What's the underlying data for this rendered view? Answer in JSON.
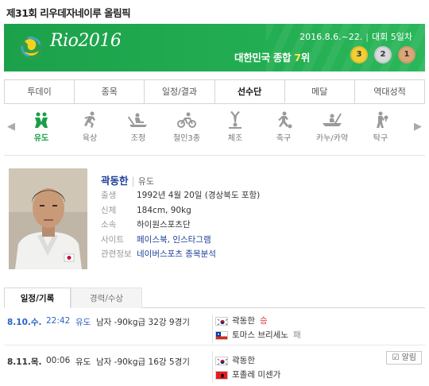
{
  "page_title": "제31회 리우데자네이루 올림픽",
  "banner": {
    "logo_text": "Rio2016",
    "dates": "2016.8.6.~22.",
    "day": "대회 5일차",
    "rank_prefix": "대한민국 종합 ",
    "rank_num": "7",
    "rank_suffix": "위",
    "medals": {
      "gold": "3",
      "silver": "2",
      "bronze": "1"
    },
    "colors": {
      "bg": "#23ad52",
      "highlight": "#ffe957"
    }
  },
  "tabs": [
    "투데이",
    "종목",
    "일정/결과",
    "선수단",
    "메달",
    "역대성적"
  ],
  "active_tab": "선수단",
  "sports": [
    {
      "label": "유도",
      "icon": "judo-icon",
      "active": true
    },
    {
      "label": "육상",
      "icon": "athletics-icon"
    },
    {
      "label": "조정",
      "icon": "rowing-icon"
    },
    {
      "label": "철인3종",
      "icon": "triathlon-icon"
    },
    {
      "label": "체조",
      "icon": "gymnastics-icon"
    },
    {
      "label": "축구",
      "icon": "football-icon"
    },
    {
      "label": "카누/카약",
      "icon": "canoe-icon"
    },
    {
      "label": "탁구",
      "icon": "table-tennis-icon"
    }
  ],
  "profile": {
    "name": "곽동한",
    "sport": "유도",
    "rows": [
      {
        "key": "출생",
        "value": "1992년 4월 20일 (경상북도 포항)"
      },
      {
        "key": "신체",
        "value": "184cm, 90kg"
      },
      {
        "key": "소속",
        "value": "하이원스포츠단"
      },
      {
        "key": "사이트",
        "value": "페이스북, 인스타그램",
        "link": true
      },
      {
        "key": "관련정보",
        "value": "네이버스포츠 종목분석",
        "link": true
      }
    ]
  },
  "subtabs": {
    "schedule": "일정/기록",
    "career": "경력/수상"
  },
  "matches": [
    {
      "date": "8.10.수.",
      "time": "22:42",
      "sport": "유도",
      "event": "남자 -90kg급 32강 9경기",
      "players": [
        {
          "flag": "korea",
          "name": "곽동한",
          "result": "승"
        },
        {
          "flag": "chile",
          "name": "토마스 브리세노",
          "result": "패"
        }
      ]
    },
    {
      "date": "8.11.목.",
      "time": "00:06",
      "sport": "유도",
      "event": "남자 -90kg급 16강 5경기",
      "players": [
        {
          "flag": "korea",
          "name": "곽동한",
          "result": ""
        },
        {
          "flag": "albania",
          "name": "포졸레 미센가",
          "result": ""
        }
      ],
      "alarm": "알림"
    }
  ]
}
